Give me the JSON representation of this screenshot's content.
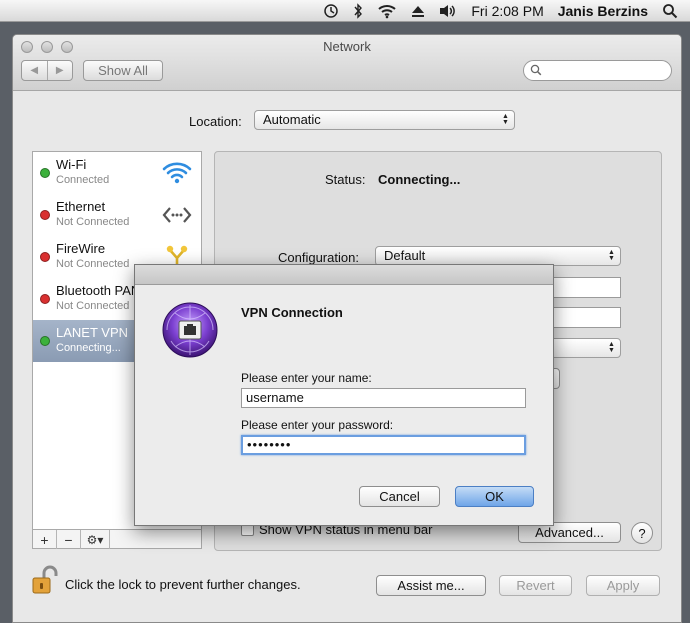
{
  "menubar": {
    "icons": [
      "time-machine-icon",
      "bluetooth-icon",
      "wifi-icon",
      "eject-icon",
      "volume-icon"
    ],
    "clock": "Fri 2:08 PM",
    "user": "Janis Berzins",
    "search_icon": "spotlight-icon"
  },
  "window": {
    "title": "Network",
    "show_all": "Show All",
    "search_placeholder": ""
  },
  "location": {
    "label": "Location:",
    "value": "Automatic"
  },
  "services": [
    {
      "name": "Wi-Fi",
      "status": "Connected",
      "color": "#3cb13c",
      "icon": "wifi-icon"
    },
    {
      "name": "Ethernet",
      "status": "Not Connected",
      "color": "#d93030",
      "icon": "ethernet-icon"
    },
    {
      "name": "FireWire",
      "status": "Not Connected",
      "color": "#d93030",
      "icon": "firewire-icon"
    },
    {
      "name": "Bluetooth PAN",
      "status": "Not Connected",
      "color": "#d93030",
      "icon": "bluetooth-icon"
    },
    {
      "name": "LANET VPN",
      "status": "Connecting...",
      "color": "#3cb13c",
      "icon": "vpn-icon"
    }
  ],
  "sidebar_tools": {
    "add": "+",
    "remove": "−",
    "gear": "⚙▾"
  },
  "detail": {
    "status_label": "Status:",
    "status_value": "Connecting...",
    "configuration_label": "Configuration:",
    "configuration_value": "Default",
    "show_vpn_label": "Show VPN status in menu bar",
    "advanced": "Advanced...",
    "help": "?"
  },
  "bottom": {
    "lock_text": "Click the lock to prevent further changes.",
    "assist": "Assist me...",
    "revert": "Revert",
    "apply": "Apply"
  },
  "dialog": {
    "title": "VPN Connection",
    "name_label": "Please enter your name:",
    "name_value": "username",
    "password_label": "Please enter your password:",
    "password_value": "••••••••",
    "cancel": "Cancel",
    "ok": "OK"
  }
}
